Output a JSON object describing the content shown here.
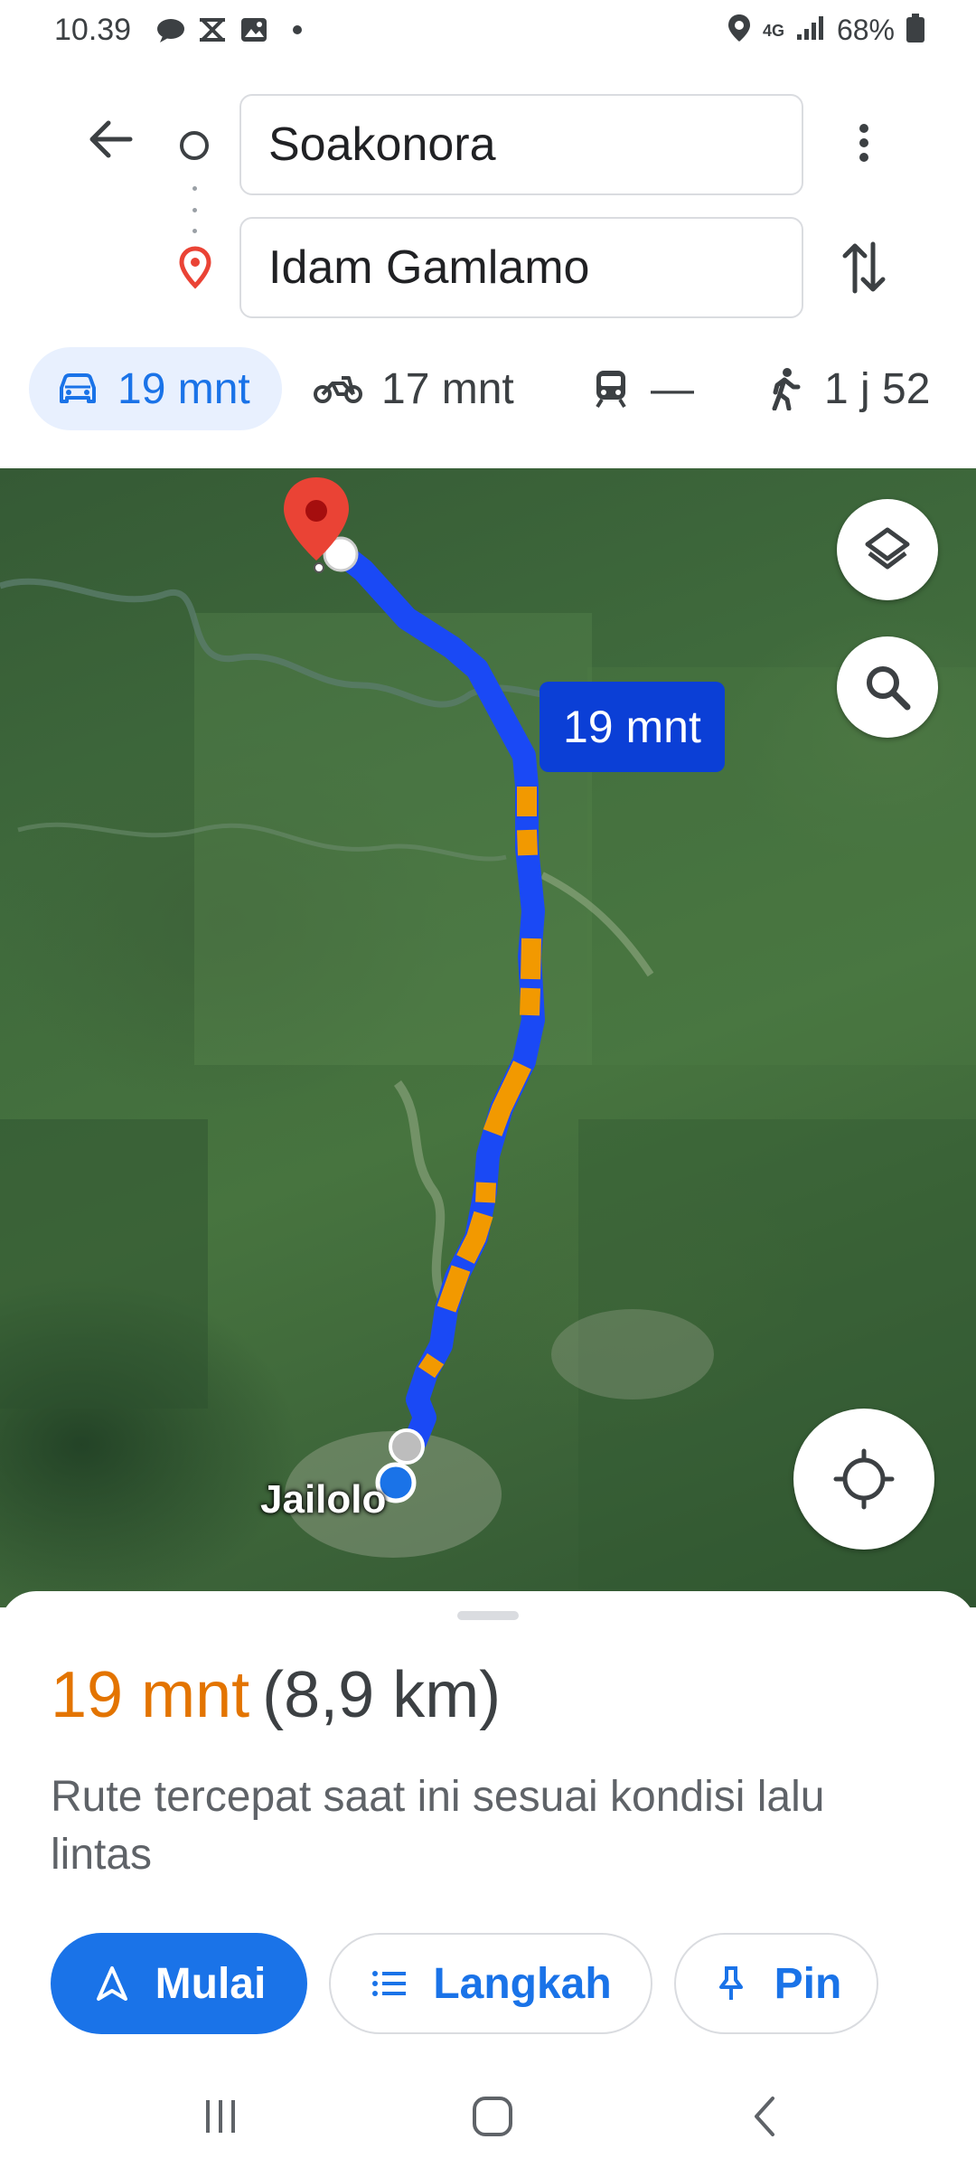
{
  "status_bar": {
    "time": "10.39",
    "network": "4G",
    "battery": "68%"
  },
  "route": {
    "origin": "Soakonora",
    "destination": "Idam Gamlamo"
  },
  "modes": [
    {
      "name": "car",
      "label": "19 mnt",
      "active": true
    },
    {
      "name": "motorcycle",
      "label": "17 mnt",
      "active": false
    },
    {
      "name": "transit",
      "label": "—",
      "active": false
    },
    {
      "name": "walk",
      "label": "1 j 52",
      "active": false
    }
  ],
  "map": {
    "eta_bubble": "19 mnt",
    "city_label": "Jailolo",
    "colors": {
      "route_fast": "#1a49f5",
      "route_slow": "#f29900",
      "pin": "#ea4335"
    }
  },
  "summary": {
    "time": "19 mnt",
    "distance": "(8,9 km)",
    "description": "Rute tercepat saat ini sesuai kondisi lalu lintas"
  },
  "actions": {
    "start": "Mulai",
    "steps": "Langkah",
    "pin": "Pin"
  },
  "colors": {
    "accent": "#1a73e8",
    "eta_orange": "#e37400"
  }
}
